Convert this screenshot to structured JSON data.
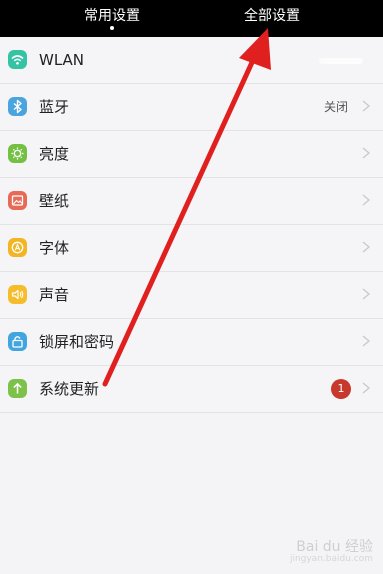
{
  "tabs": {
    "common_label": "常用设置",
    "all_label": "全部设置"
  },
  "settings": {
    "items": [
      {
        "label": "WLAN",
        "icon": "wifi-icon",
        "color": "#35c3a4"
      },
      {
        "label": "蓝牙",
        "icon": "bluetooth-icon",
        "color": "#4aa5de",
        "value": "关闭"
      },
      {
        "label": "亮度",
        "icon": "brightness-icon",
        "color": "#73c043"
      },
      {
        "label": "壁纸",
        "icon": "wallpaper-icon",
        "color": "#e66a55"
      },
      {
        "label": "字体",
        "icon": "font-icon",
        "color": "#f2b523"
      },
      {
        "label": "声音",
        "icon": "sound-icon",
        "color": "#f5bd2b"
      },
      {
        "label": "锁屏和密码",
        "icon": "lock-icon",
        "color": "#41a6e0"
      },
      {
        "label": "系统更新",
        "icon": "system-update-icon",
        "color": "#7cc24a",
        "badge": "1"
      }
    ]
  },
  "watermark": {
    "brand": "Bai du 经验",
    "url": "jingyan.baidu.com"
  },
  "annotation": {
    "color": "#e0201f"
  }
}
